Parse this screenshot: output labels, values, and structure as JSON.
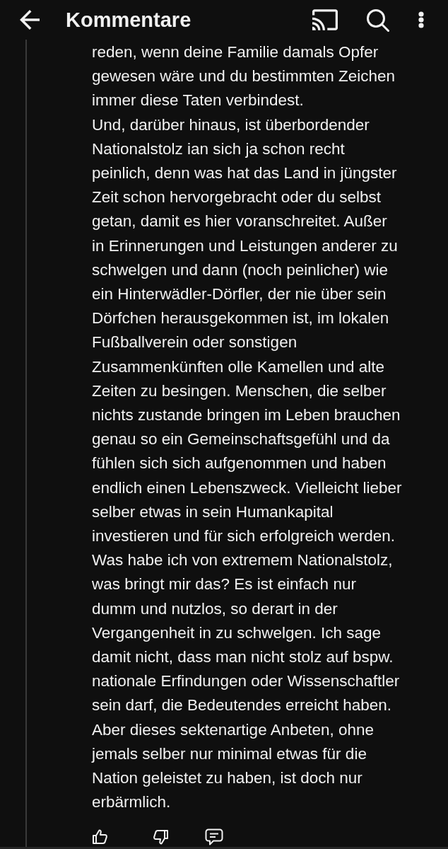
{
  "app_bar": {
    "title": "Kommentare"
  },
  "comment": {
    "text": "reden, wenn deine Familie damals Opfer\ngewesen wäre und du bestimmten Zeichen\nimmer diese Taten verbindest.\nUnd, darüber hinaus, ist überbordender\nNationalstolz ian sich ja schon recht\npeinlich, denn was hat das Land in jüngster\nZeit schon hervorgebracht oder du selbst\ngetan, damit es hier voranschreitet. Außer\nin Erinnerungen und Leistungen anderer zu\nschwelgen und dann (noch peinlicher) wie\nein Hinterwädler-Dörfler, der nie über sein\nDörfchen herausgekommen ist, im lokalen\nFußballverein oder sonstigen\nZusammenkünften olle Kamellen und alte\nZeiten zu besingen. Menschen, die selber\nnichts zustande bringen im Leben brauchen\ngenau so ein Gemeinschaftsgefühl und da\nfühlen sich sich aufgenommen und haben\nendlich einen Lebenszweck. Vielleicht lieber\nselber etwas in sein Humankapital\ninvestieren und für sich erfolgreich werden.\nWas habe ich von extremem Nationalstolz,\nwas bringt mir das? Es ist einfach nur\ndumm und nutzlos, so derart in der\nVergangenheit in zu schwelgen. Ich sage\ndamit nicht, dass man nicht stolz auf bspw.\nnationale Erfindungen oder Wissenschaftler\nsein darf, die Bedeutendes erreicht haben.\nAber dieses sektenartige Anbeten, ohne\njemals selber nur minimal etwas für die\nNation geleistet zu haben, ist doch nur\nerbärmlich."
  }
}
